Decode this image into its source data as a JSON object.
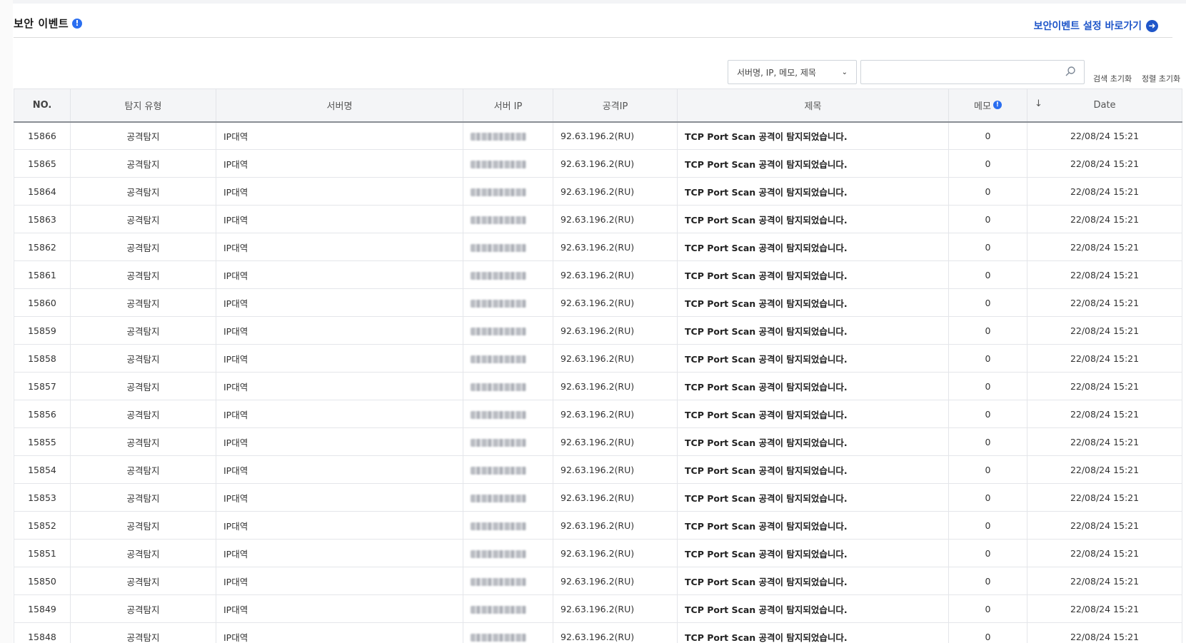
{
  "page": {
    "title": "보안 이벤트",
    "title_icon": "info-icon",
    "settings_link": "보안이벤트 설정 바로가기",
    "settings_link_icon": "arrow-right-circle-icon",
    "accent_color": "#1f56c9"
  },
  "search": {
    "select_value": "서버명, IP, 메모, 제목",
    "input_value": "",
    "reset_search_label": "검색 초기화",
    "reset_sort_label": "정렬 초기화"
  },
  "table": {
    "headers": {
      "no": "NO.",
      "type": "탐지 유형",
      "server": "서버명",
      "server_ip": "서버 IP",
      "attack_ip": "공격IP",
      "subject": "제목",
      "memo": "메모",
      "date": "Date"
    },
    "rows": [
      {
        "no": "15866",
        "type": "공격탐지",
        "server": "IP대역",
        "attack_ip": "92.63.196.2(RU)",
        "subject": "TCP Port Scan 공격이 탐지되었습니다.",
        "memo": "0",
        "date": "22/08/24 15:21"
      },
      {
        "no": "15865",
        "type": "공격탐지",
        "server": "IP대역",
        "attack_ip": "92.63.196.2(RU)",
        "subject": "TCP Port Scan 공격이 탐지되었습니다.",
        "memo": "0",
        "date": "22/08/24 15:21"
      },
      {
        "no": "15864",
        "type": "공격탐지",
        "server": "IP대역",
        "attack_ip": "92.63.196.2(RU)",
        "subject": "TCP Port Scan 공격이 탐지되었습니다.",
        "memo": "0",
        "date": "22/08/24 15:21"
      },
      {
        "no": "15863",
        "type": "공격탐지",
        "server": "IP대역",
        "attack_ip": "92.63.196.2(RU)",
        "subject": "TCP Port Scan 공격이 탐지되었습니다.",
        "memo": "0",
        "date": "22/08/24 15:21"
      },
      {
        "no": "15862",
        "type": "공격탐지",
        "server": "IP대역",
        "attack_ip": "92.63.196.2(RU)",
        "subject": "TCP Port Scan 공격이 탐지되었습니다.",
        "memo": "0",
        "date": "22/08/24 15:21"
      },
      {
        "no": "15861",
        "type": "공격탐지",
        "server": "IP대역",
        "attack_ip": "92.63.196.2(RU)",
        "subject": "TCP Port Scan 공격이 탐지되었습니다.",
        "memo": "0",
        "date": "22/08/24 15:21"
      },
      {
        "no": "15860",
        "type": "공격탐지",
        "server": "IP대역",
        "attack_ip": "92.63.196.2(RU)",
        "subject": "TCP Port Scan 공격이 탐지되었습니다.",
        "memo": "0",
        "date": "22/08/24 15:21"
      },
      {
        "no": "15859",
        "type": "공격탐지",
        "server": "IP대역",
        "attack_ip": "92.63.196.2(RU)",
        "subject": "TCP Port Scan 공격이 탐지되었습니다.",
        "memo": "0",
        "date": "22/08/24 15:21"
      },
      {
        "no": "15858",
        "type": "공격탐지",
        "server": "IP대역",
        "attack_ip": "92.63.196.2(RU)",
        "subject": "TCP Port Scan 공격이 탐지되었습니다.",
        "memo": "0",
        "date": "22/08/24 15:21"
      },
      {
        "no": "15857",
        "type": "공격탐지",
        "server": "IP대역",
        "attack_ip": "92.63.196.2(RU)",
        "subject": "TCP Port Scan 공격이 탐지되었습니다.",
        "memo": "0",
        "date": "22/08/24 15:21"
      },
      {
        "no": "15856",
        "type": "공격탐지",
        "server": "IP대역",
        "attack_ip": "92.63.196.2(RU)",
        "subject": "TCP Port Scan 공격이 탐지되었습니다.",
        "memo": "0",
        "date": "22/08/24 15:21"
      },
      {
        "no": "15855",
        "type": "공격탐지",
        "server": "IP대역",
        "attack_ip": "92.63.196.2(RU)",
        "subject": "TCP Port Scan 공격이 탐지되었습니다.",
        "memo": "0",
        "date": "22/08/24 15:21"
      },
      {
        "no": "15854",
        "type": "공격탐지",
        "server": "IP대역",
        "attack_ip": "92.63.196.2(RU)",
        "subject": "TCP Port Scan 공격이 탐지되었습니다.",
        "memo": "0",
        "date": "22/08/24 15:21"
      },
      {
        "no": "15853",
        "type": "공격탐지",
        "server": "IP대역",
        "attack_ip": "92.63.196.2(RU)",
        "subject": "TCP Port Scan 공격이 탐지되었습니다.",
        "memo": "0",
        "date": "22/08/24 15:21"
      },
      {
        "no": "15852",
        "type": "공격탐지",
        "server": "IP대역",
        "attack_ip": "92.63.196.2(RU)",
        "subject": "TCP Port Scan 공격이 탐지되었습니다.",
        "memo": "0",
        "date": "22/08/24 15:21"
      },
      {
        "no": "15851",
        "type": "공격탐지",
        "server": "IP대역",
        "attack_ip": "92.63.196.2(RU)",
        "subject": "TCP Port Scan 공격이 탐지되었습니다.",
        "memo": "0",
        "date": "22/08/24 15:21"
      },
      {
        "no": "15850",
        "type": "공격탐지",
        "server": "IP대역",
        "attack_ip": "92.63.196.2(RU)",
        "subject": "TCP Port Scan 공격이 탐지되었습니다.",
        "memo": "0",
        "date": "22/08/24 15:21"
      },
      {
        "no": "15849",
        "type": "공격탐지",
        "server": "IP대역",
        "attack_ip": "92.63.196.2(RU)",
        "subject": "TCP Port Scan 공격이 탐지되었습니다.",
        "memo": "0",
        "date": "22/08/24 15:21"
      },
      {
        "no": "15848",
        "type": "공격탐지",
        "server": "IP대역",
        "attack_ip": "92.63.196.2(RU)",
        "subject": "TCP Port Scan 공격이 탐지되었습니다.",
        "memo": "0",
        "date": "22/08/24 15:21"
      }
    ]
  }
}
